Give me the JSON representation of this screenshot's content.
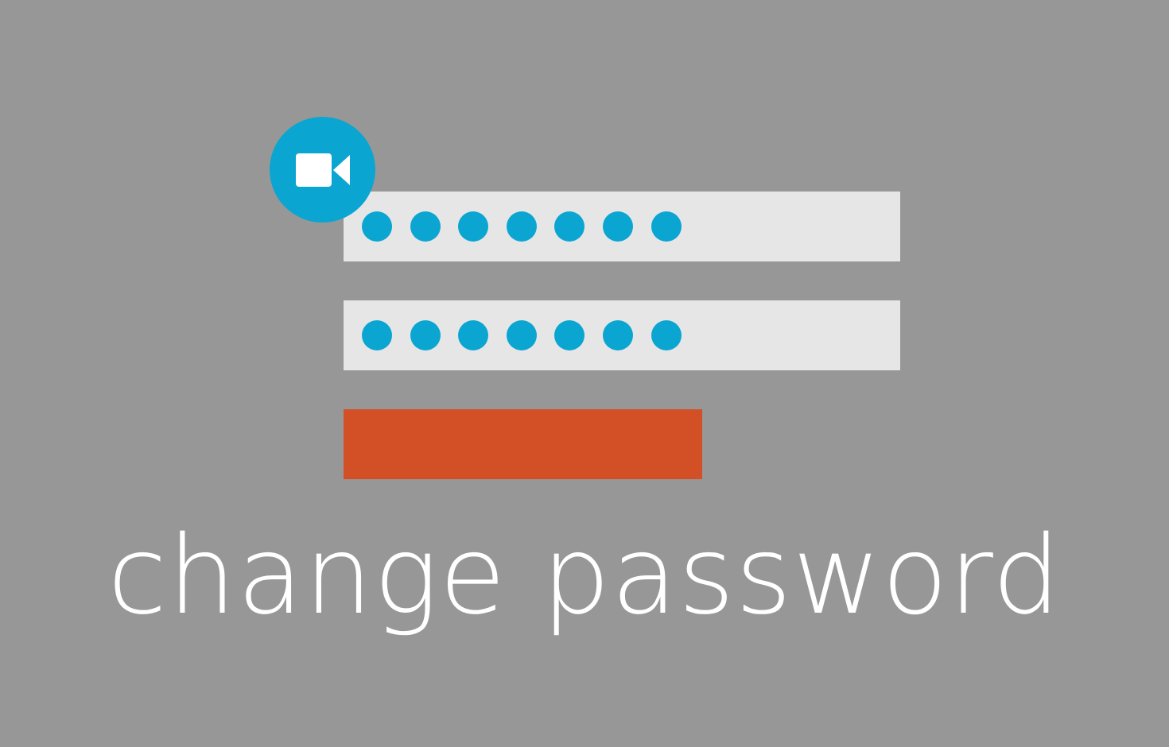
{
  "caption": "change password",
  "icons": {
    "badge": "video-camera-icon"
  },
  "password_fields": [
    {
      "masked_length": 7
    },
    {
      "masked_length": 7
    }
  ],
  "colors": {
    "background": "#979797",
    "field": "#e6e6e6",
    "mask_dot": "#0ba5d1",
    "badge": "#0ba5d1",
    "submit": "#d35026",
    "caption": "#ffffff"
  }
}
